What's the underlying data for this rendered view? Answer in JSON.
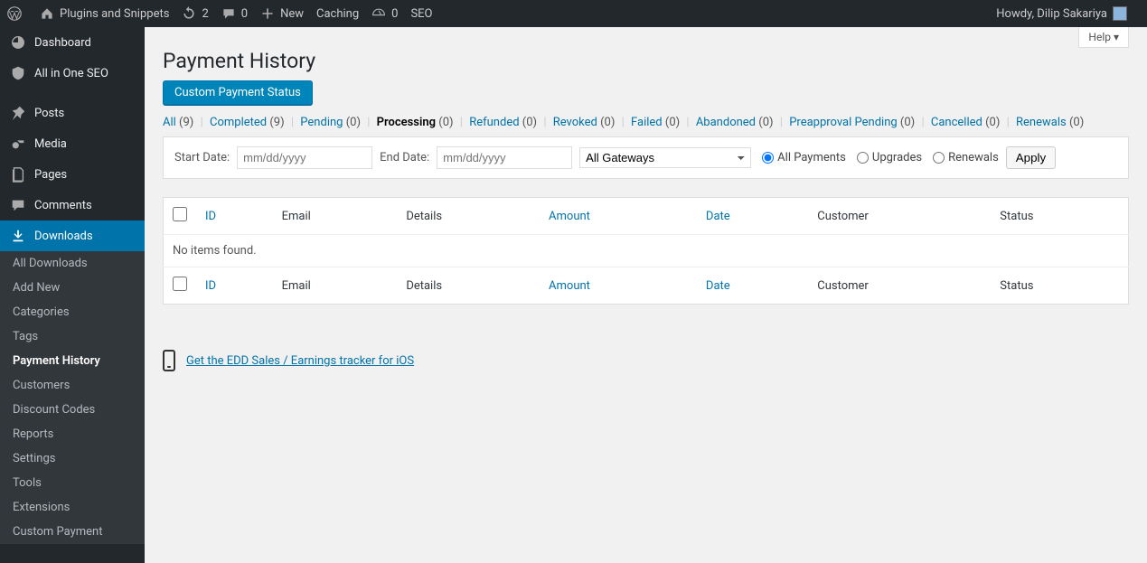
{
  "adminbar": {
    "site_name": "Plugins and Snippets",
    "updates": "2",
    "comments": "0",
    "new": "New",
    "caching": "Caching",
    "perf_count": "0",
    "seo": "SEO",
    "howdy": "Howdy, Dilip Sakariya"
  },
  "sidebar": {
    "dashboard": "Dashboard",
    "aioseo": "All in One SEO",
    "posts": "Posts",
    "media": "Media",
    "pages": "Pages",
    "comments": "Comments",
    "downloads": "Downloads",
    "submenu": {
      "all": "All Downloads",
      "add_new": "Add New",
      "categories": "Categories",
      "tags": "Tags",
      "payment_history": "Payment History",
      "customers": "Customers",
      "discount_codes": "Discount Codes",
      "reports": "Reports",
      "settings": "Settings",
      "tools": "Tools",
      "extensions": "Extensions",
      "custom_payment": "Custom Payment"
    }
  },
  "page": {
    "help": "Help ▾",
    "title": "Payment History",
    "button": "Custom Payment Status"
  },
  "filters": {
    "all": "All",
    "all_count": "(9)",
    "completed": "Completed",
    "completed_count": "(9)",
    "pending": "Pending",
    "pending_count": "(0)",
    "processing": "Processing",
    "processing_count": "(0)",
    "refunded": "Refunded",
    "refunded_count": "(0)",
    "revoked": "Revoked",
    "revoked_count": "(0)",
    "failed": "Failed",
    "failed_count": "(0)",
    "abandoned": "Abandoned",
    "abandoned_count": "(0)",
    "preapproval": "Preapproval Pending",
    "preapproval_count": "(0)",
    "cancelled": "Cancelled",
    "cancelled_count": "(0)",
    "renewals": "Renewals",
    "renewals_count": "(0)"
  },
  "form": {
    "start_label": "Start Date:",
    "end_label": "End Date:",
    "placeholder": "mm/dd/yyyy",
    "gateway_selected": "All Gateways",
    "radio_all": "All Payments",
    "radio_upgrades": "Upgrades",
    "radio_renewals": "Renewals",
    "apply": "Apply"
  },
  "table": {
    "cols": {
      "id": "ID",
      "email": "Email",
      "details": "Details",
      "amount": "Amount",
      "date": "Date",
      "customer": "Customer",
      "status": "Status"
    },
    "empty": "No items found."
  },
  "footer_link": "Get the EDD Sales / Earnings tracker for iOS"
}
